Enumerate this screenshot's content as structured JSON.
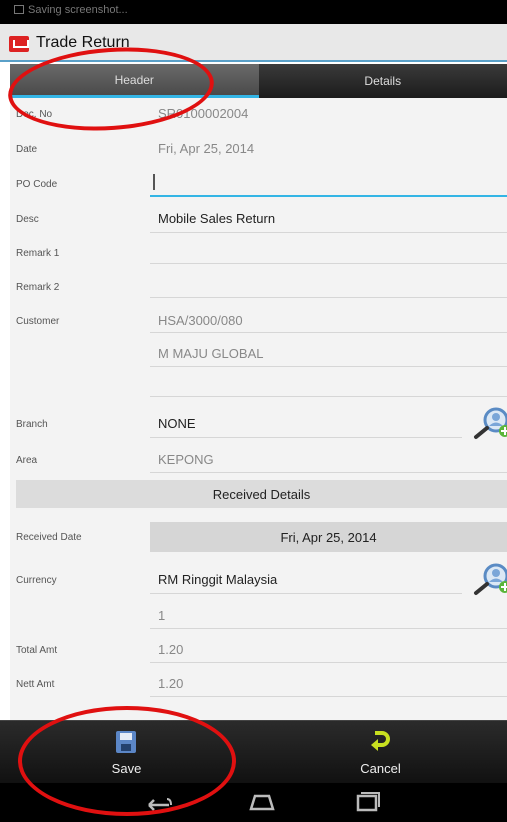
{
  "status_bar": {
    "notification": "Saving screenshot..."
  },
  "app": {
    "title": "Trade Return"
  },
  "tabs": [
    {
      "label": "Header",
      "active": true
    },
    {
      "label": "Details",
      "active": false
    }
  ],
  "form": {
    "doc_no": {
      "label": "Doc. No",
      "value": "SR0100002004"
    },
    "date": {
      "label": "Date",
      "value": "Fri, Apr 25, 2014"
    },
    "po_code": {
      "label": "PO Code",
      "value": ""
    },
    "desc": {
      "label": "Desc",
      "value": "Mobile Sales Return"
    },
    "remark1": {
      "label": "Remark 1",
      "value": ""
    },
    "remark2": {
      "label": "Remark 2",
      "value": ""
    },
    "customer": {
      "label": "Customer",
      "code": "HSA/3000/080",
      "name": "M MAJU GLOBAL"
    },
    "branch": {
      "label": "Branch",
      "value": "NONE"
    },
    "area": {
      "label": "Area",
      "value": "KEPONG"
    }
  },
  "received": {
    "section_title": "Received Details",
    "date": {
      "label": "Received Date",
      "value": "Fri, Apr 25, 2014"
    },
    "currency": {
      "label": "Currency",
      "value": "RM Ringgit Malaysia",
      "rate": "1"
    },
    "total_amt": {
      "label": "Total Amt",
      "value": "1.20"
    },
    "nett_amt": {
      "label": "Nett Amt",
      "value": "1.20"
    }
  },
  "actions": {
    "save_label": "Save",
    "cancel_label": "Cancel"
  },
  "icons": {
    "app": "trade-return-app-icon",
    "lookup": "search-person-add-icon",
    "save": "floppy-disk-icon",
    "cancel": "undo-arrow-icon",
    "back": "back-icon",
    "home": "home-icon",
    "recents": "recents-icon"
  },
  "colors": {
    "accent": "#33b5e5",
    "annotation": "#e01010",
    "save_icon": "#5b86c6",
    "cancel_icon": "#c8e020"
  }
}
